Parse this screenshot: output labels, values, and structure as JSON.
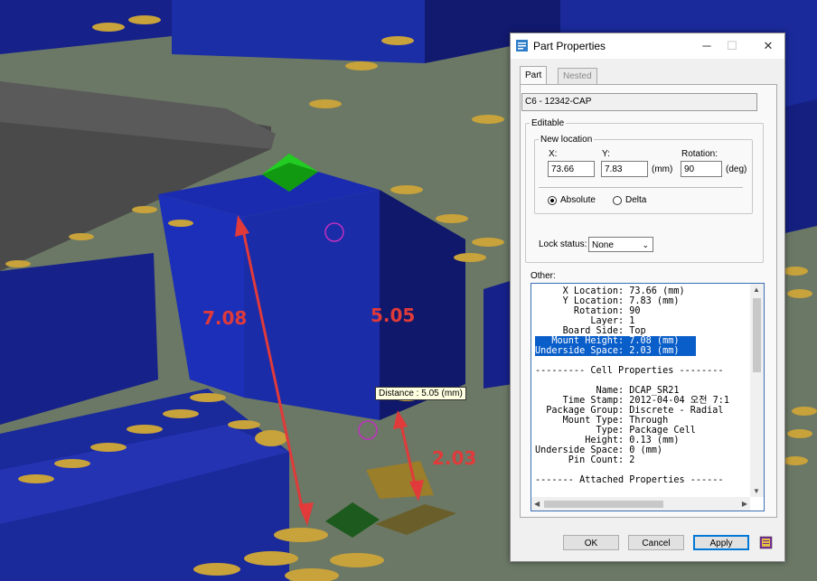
{
  "annotations": {
    "left_height": "7.08",
    "top_height": "5.05",
    "underside": "2.03",
    "tooltip": "Distance : 5.05 (mm)"
  },
  "dialog": {
    "title": "Part Properties",
    "title_buttons": {
      "minimize": "─",
      "maximize": "☐",
      "close": "✕"
    },
    "tabs": [
      "Part",
      "Nested Cells"
    ],
    "part_name": "C6 - 12342-CAP",
    "editable_label": "Editable",
    "new_location_label": "New location",
    "x_label": "X:",
    "x_value": "73.66",
    "y_label": "Y:",
    "y_value": "7.83",
    "unit_mm": "(mm)",
    "rotation_label": "Rotation:",
    "rotation_value": "90",
    "unit_deg": "(deg)",
    "absolute_label": "Absolute",
    "delta_label": "Delta",
    "lock_status_label": "Lock status:",
    "lock_status_value": "None",
    "other_label": "Other:",
    "other_lines": [
      "     X Location: 73.66 (mm)",
      "     Y Location: 7.83 (mm)",
      "       Rotation: 90",
      "          Layer: 1",
      "     Board Side: Top",
      "   Mount Height: 7.08 (mm)",
      "Underside Space: 2.03 (mm)",
      "",
      "--------- Cell Properties --------",
      "",
      "           Name: DCAP_SR21",
      "     Time Stamp: 2012-04-04 오전 7:1",
      "  Package Group: Discrete - Radial",
      "     Mount Type: Through",
      "           Type: Package Cell",
      "         Height: 0.13 (mm)",
      "Underside Space: 0 (mm)",
      "      Pin Count: 2",
      "",
      "------- Attached Properties ------"
    ],
    "buttons": {
      "ok": "OK",
      "cancel": "Cancel",
      "apply": "Apply"
    }
  },
  "colors": {
    "board": "#6d7a66",
    "component_blue": "#1a2a9a",
    "pad_gold": "#c8a23a",
    "annotation_red": "#e03a3a",
    "selection": "#0a5ec9"
  }
}
